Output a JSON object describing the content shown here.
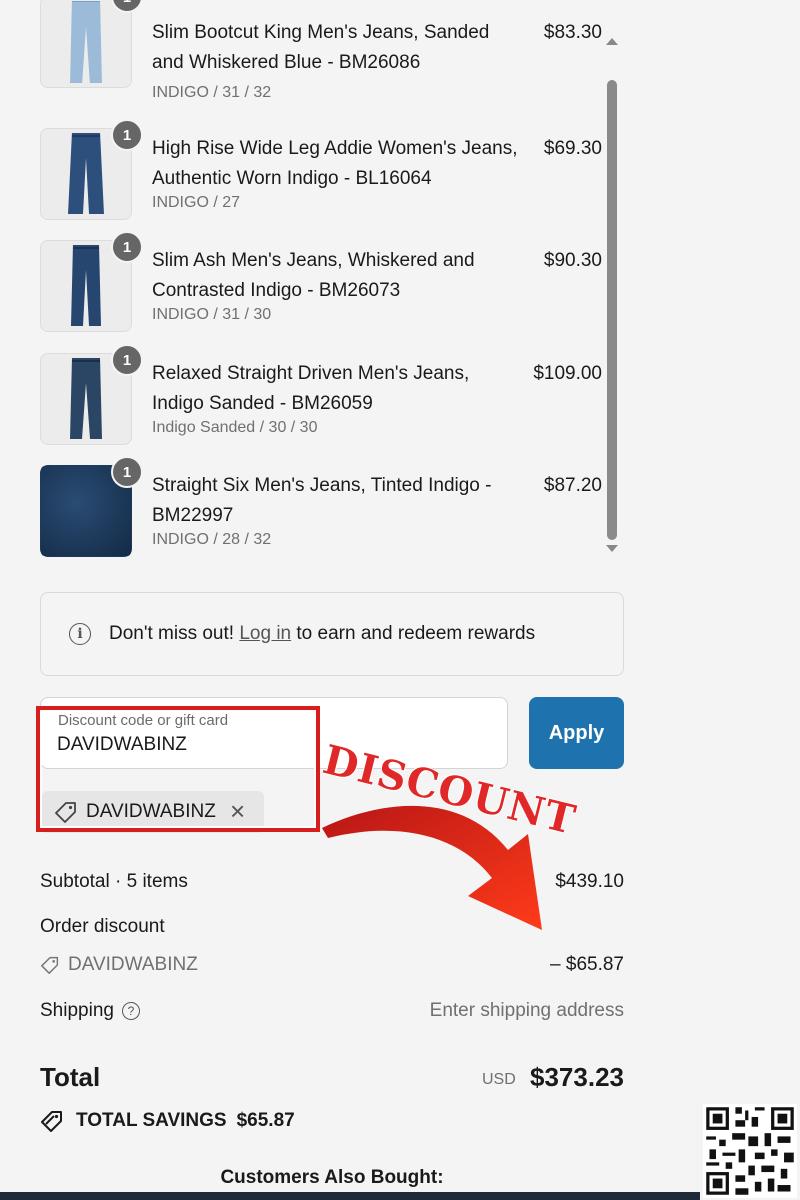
{
  "cart": {
    "items": [
      {
        "name": "Slim Bootcut King Men's Jeans, Sanded and Whiskered Blue - BM26086",
        "variant": "INDIGO / 31 / 32",
        "price": "$83.30",
        "qty": "1",
        "thumb_color": "#8fb0d0"
      },
      {
        "name": "High Rise Wide Leg Addie Women's Jeans, Authentic Worn Indigo - BL16064",
        "variant": "INDIGO / 27",
        "price": "$69.30",
        "qty": "1",
        "thumb_color": "#2c4f7c"
      },
      {
        "name": "Slim Ash Men's Jeans, Whiskered and Contrasted Indigo - BM26073",
        "variant": "INDIGO / 31 / 30",
        "price": "$90.30",
        "qty": "1",
        "thumb_color": "#26466f"
      },
      {
        "name": "Relaxed Straight Driven Men's Jeans, Indigo Sanded - BM26059",
        "variant": "Indigo Sanded / 30 / 30",
        "price": "$109.00",
        "qty": "1",
        "thumb_color": "#2b4565"
      },
      {
        "name": "Straight Six Men's Jeans, Tinted Indigo - BM22997",
        "variant": "INDIGO / 28 / 32",
        "price": "$87.20",
        "qty": "1",
        "thumb_color": "#1d3a5c"
      }
    ]
  },
  "rewards": {
    "prefix": "Don't miss out! ",
    "link": "Log in",
    "suffix": " to earn and redeem rewards"
  },
  "discount": {
    "placeholder": "Discount code or gift card",
    "value": "DAVIDWABINZ",
    "apply_label": "Apply",
    "chip_code": "DAVIDWABINZ",
    "overlay_text": "DISCOUNT"
  },
  "summary": {
    "subtotal_label": "Subtotal · 5 items",
    "subtotal_value": "$439.10",
    "order_discount_label": "Order discount",
    "discount_code": "DAVIDWABINZ",
    "discount_value": "– $65.87",
    "shipping_label": "Shipping",
    "shipping_value": "Enter shipping address",
    "total_label": "Total",
    "currency": "USD",
    "total_value": "$373.23",
    "savings_label": "TOTAL SAVINGS",
    "savings_value": "$65.87"
  },
  "also_bought": "Customers Also Bought:",
  "colors": {
    "accent": "#1e73ae",
    "highlight": "#d81d1d"
  }
}
